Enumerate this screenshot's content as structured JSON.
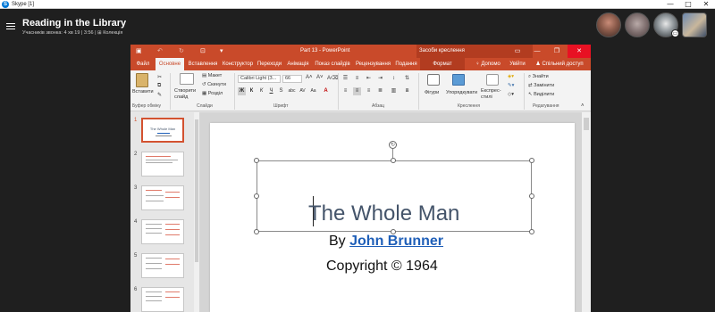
{
  "window": {
    "app_name": "Skype [1]",
    "controls": [
      "—",
      "□",
      "✕"
    ]
  },
  "conversation": {
    "title": "Reading in the Library",
    "subtitle": "Учасників звонка: 4 хв 19 | 3:56 | ⊞ Колекція"
  },
  "participants": [
    {
      "name": "participant-1"
    },
    {
      "name": "participant-2"
    },
    {
      "name": "participant-3"
    },
    {
      "name": "participant-4"
    }
  ],
  "powerpoint": {
    "document_title": "Part 13 - PowerPoint",
    "contextual_group": "Засоби креслення",
    "window_controls": [
      "▭",
      "—",
      "❐",
      "✕"
    ],
    "tabs": [
      "Файл",
      "Основне",
      "Вставлення",
      "Конструктор",
      "Переходи",
      "Анімація",
      "Показ слайдів",
      "Рецензування",
      "Подання",
      "Формат"
    ],
    "active_tab": "Основне",
    "tell_me": "Допомо",
    "sign_in": "Увійти",
    "share": "Спільний доступ",
    "ribbon": {
      "paste": "Вставити",
      "clipboard_group": "Буфер обміну",
      "new_slide": "Створити слайд",
      "layout": "Макет",
      "reset": "Скинути",
      "section": "Розділ",
      "slides_group": "Слайди",
      "font_name": "Calibri Light (З...",
      "font_size": "66",
      "font_group": "Шрифт",
      "paragraph_group": "Абзац",
      "shapes": "Фігури",
      "arrange": "Упорядкувати",
      "quick_styles": "Експрес-стилі",
      "drawing_group": "Креслення",
      "find": "Знайти",
      "replace": "Замінити",
      "select": "Виділити",
      "editing_group": "Редагування"
    },
    "thumbnails": [
      {
        "num": "1",
        "text": "The Whole Man"
      },
      {
        "num": "2"
      },
      {
        "num": "3"
      },
      {
        "num": "4"
      },
      {
        "num": "5"
      },
      {
        "num": "6"
      }
    ],
    "slide": {
      "title": "The Whole Man",
      "by": "By ",
      "author": "John Brunner",
      "copyright": "Copyright © 1964"
    }
  }
}
